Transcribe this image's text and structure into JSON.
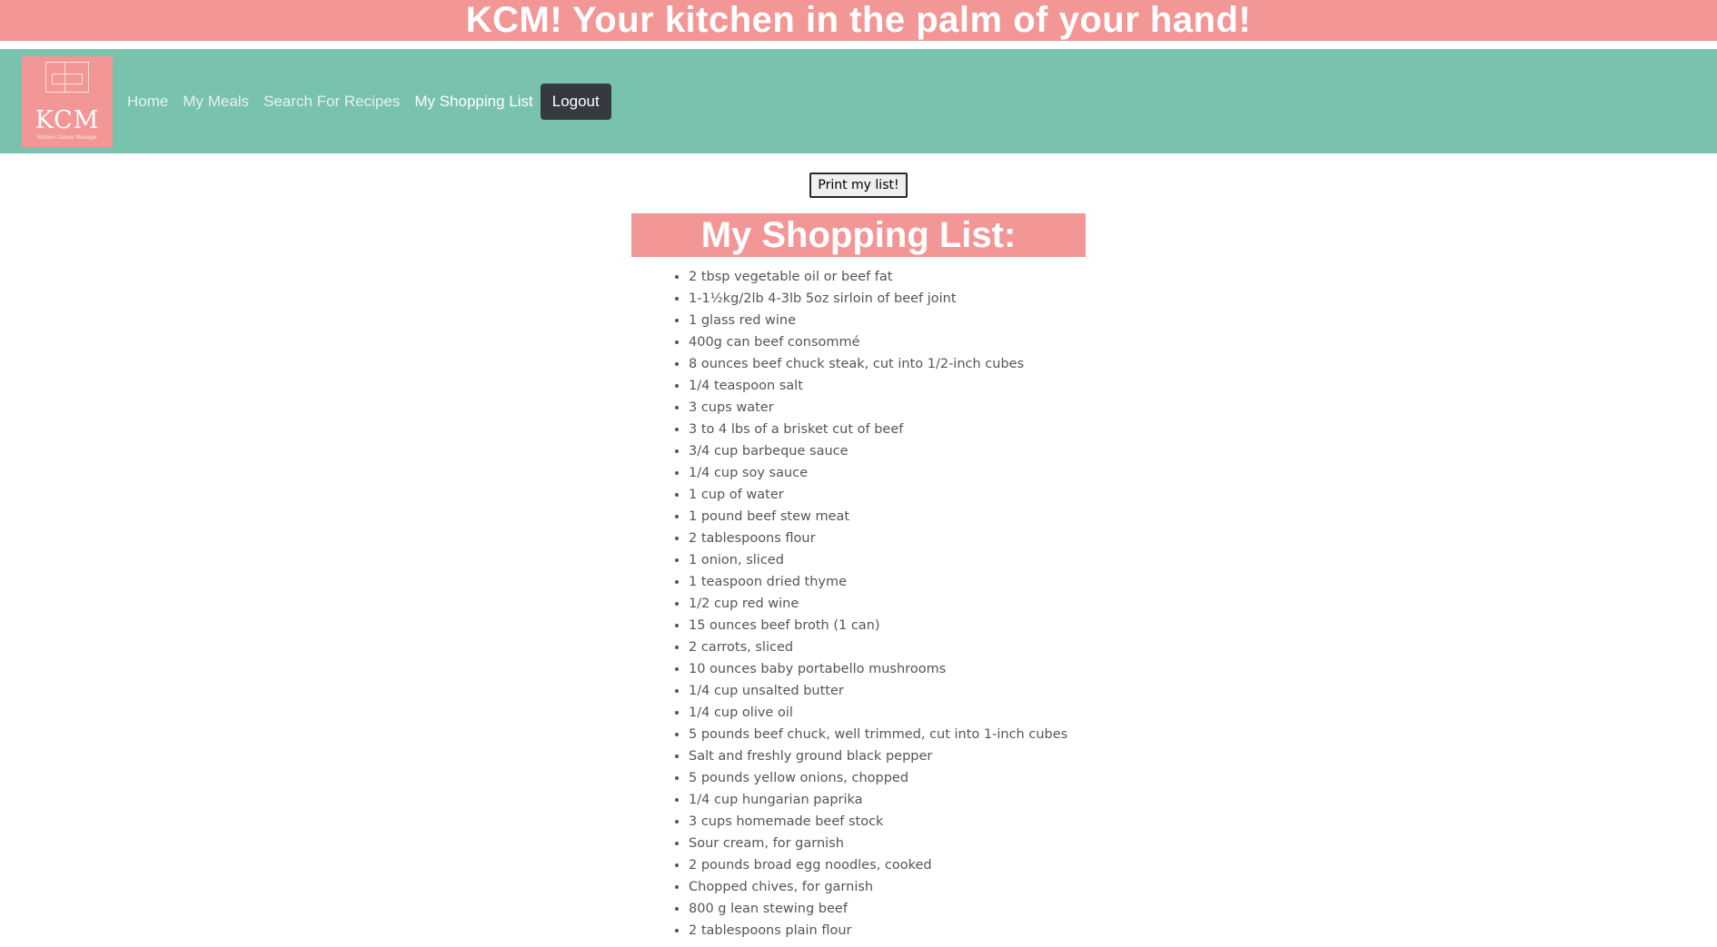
{
  "banner": {
    "title": "KCM! Your kitchen in the palm of your hand!"
  },
  "logo": {
    "text": "KCM",
    "subtext": "Kitchen Calorie Manager",
    "icon": "kitchen-cabinet-icon"
  },
  "nav": {
    "links": [
      {
        "label": "Home"
      },
      {
        "label": "My Meals"
      },
      {
        "label": "Search For Recipes"
      },
      {
        "label": "My Shopping List",
        "active": true
      }
    ],
    "logout_label": "Logout"
  },
  "main": {
    "print_label": "Print my list!",
    "list_title": "My Shopping List:",
    "items": [
      "2 tbsp vegetable oil or beef fat",
      "1-1½kg/2lb 4-3lb 5oz sirloin of beef joint",
      "1 glass red wine",
      "400g can beef consommé",
      "8 ounces beef chuck steak, cut into 1/2-inch cubes",
      "1/4 teaspoon salt",
      "3 cups water",
      "3 to 4 lbs of a brisket cut of beef",
      "3/4 cup barbeque sauce",
      "1/4 cup soy sauce",
      "1 cup of water",
      "1 pound beef stew meat",
      "2 tablespoons flour",
      "1 onion, sliced",
      "1 teaspoon dried thyme",
      "1/2 cup red wine",
      "15 ounces beef broth (1 can)",
      "2 carrots, sliced",
      "10 ounces baby portabello mushrooms",
      "1/4 cup unsalted butter",
      "1/4 cup olive oil",
      "5 pounds beef chuck, well trimmed, cut into 1-inch cubes",
      "Salt and freshly ground black pepper",
      "5 pounds yellow onions, chopped",
      "1/4 cup hungarian paprika",
      "3 cups homemade beef stock",
      "Sour cream, for garnish",
      "2 pounds broad egg noodles, cooked",
      "Chopped chives, for garnish",
      "800 g lean stewing beef",
      "2 tablespoons plain flour"
    ]
  },
  "colors": {
    "banner": "#f29696",
    "navbar": "#79c2ad",
    "logout": "#343a40"
  }
}
